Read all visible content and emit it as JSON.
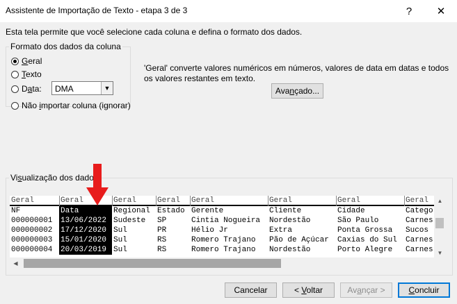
{
  "window": {
    "title": "Assistente de Importação de Texto - etapa 3 de 3",
    "help_glyph": "?",
    "close_glyph": "✕"
  },
  "intro": "Esta tela permite que você selecione cada coluna e defina o formato dos dados.",
  "format_group": {
    "legend": "Formato dos dados da coluna",
    "options": [
      {
        "label": "Geral",
        "checked": true
      },
      {
        "label": "Texto",
        "checked": false
      },
      {
        "label": "Data:",
        "checked": false
      },
      {
        "label": "Não importar coluna (ignorar)",
        "checked": false
      }
    ],
    "date_format": "DMA"
  },
  "description": "'Geral' converte valores numéricos em números, valores de data em datas e todos os valores restantes em texto.",
  "advanced_button": "Avançado...",
  "preview": {
    "legend": "Visualização dos dados",
    "columns": [
      {
        "head": "Geral",
        "cells": [
          "NF",
          "000000001",
          "000000002",
          "000000003",
          "000000004"
        ],
        "selected": false
      },
      {
        "head": "Geral",
        "cells": [
          "Data",
          "13/06/2022",
          "17/12/2020",
          "15/01/2020",
          "20/03/2019"
        ],
        "selected": true
      },
      {
        "head": "Geral",
        "cells": [
          "Regional",
          "Sudeste",
          "Sul",
          "Sul",
          "Sul"
        ],
        "selected": false
      },
      {
        "head": "Geral",
        "cells": [
          "Estado",
          "SP",
          "PR",
          "RS",
          "RS"
        ],
        "selected": false
      },
      {
        "head": "Geral",
        "cells": [
          "Gerente",
          "Cintia Nogueira",
          "Hélio Jr",
          "Romero Trajano",
          "Romero Trajano"
        ],
        "selected": false
      },
      {
        "head": "Geral",
        "cells": [
          "Cliente",
          "Nordestão",
          "Extra",
          "Pão de Açúcar",
          "Nordestão"
        ],
        "selected": false
      },
      {
        "head": "Geral",
        "cells": [
          "Cidade",
          "São Paulo",
          "Ponta Grossa",
          "Caxias do Sul",
          "Porto Alegre"
        ],
        "selected": false
      },
      {
        "head": "Geral",
        "cells": [
          "Catego",
          "Carnes",
          "Sucos",
          "Carnes",
          "Carnes"
        ],
        "selected": false
      }
    ]
  },
  "buttons": {
    "cancel": "Cancelar",
    "back": "< Voltar",
    "next": "Avançar >",
    "finish": "Concluir"
  },
  "colors": {
    "annotation_arrow": "#e81c1c",
    "default_button_border": "#0078d7"
  },
  "icons": {
    "annotation": "red-down-arrow-icon",
    "dropdown": "chevron-down-icon"
  }
}
